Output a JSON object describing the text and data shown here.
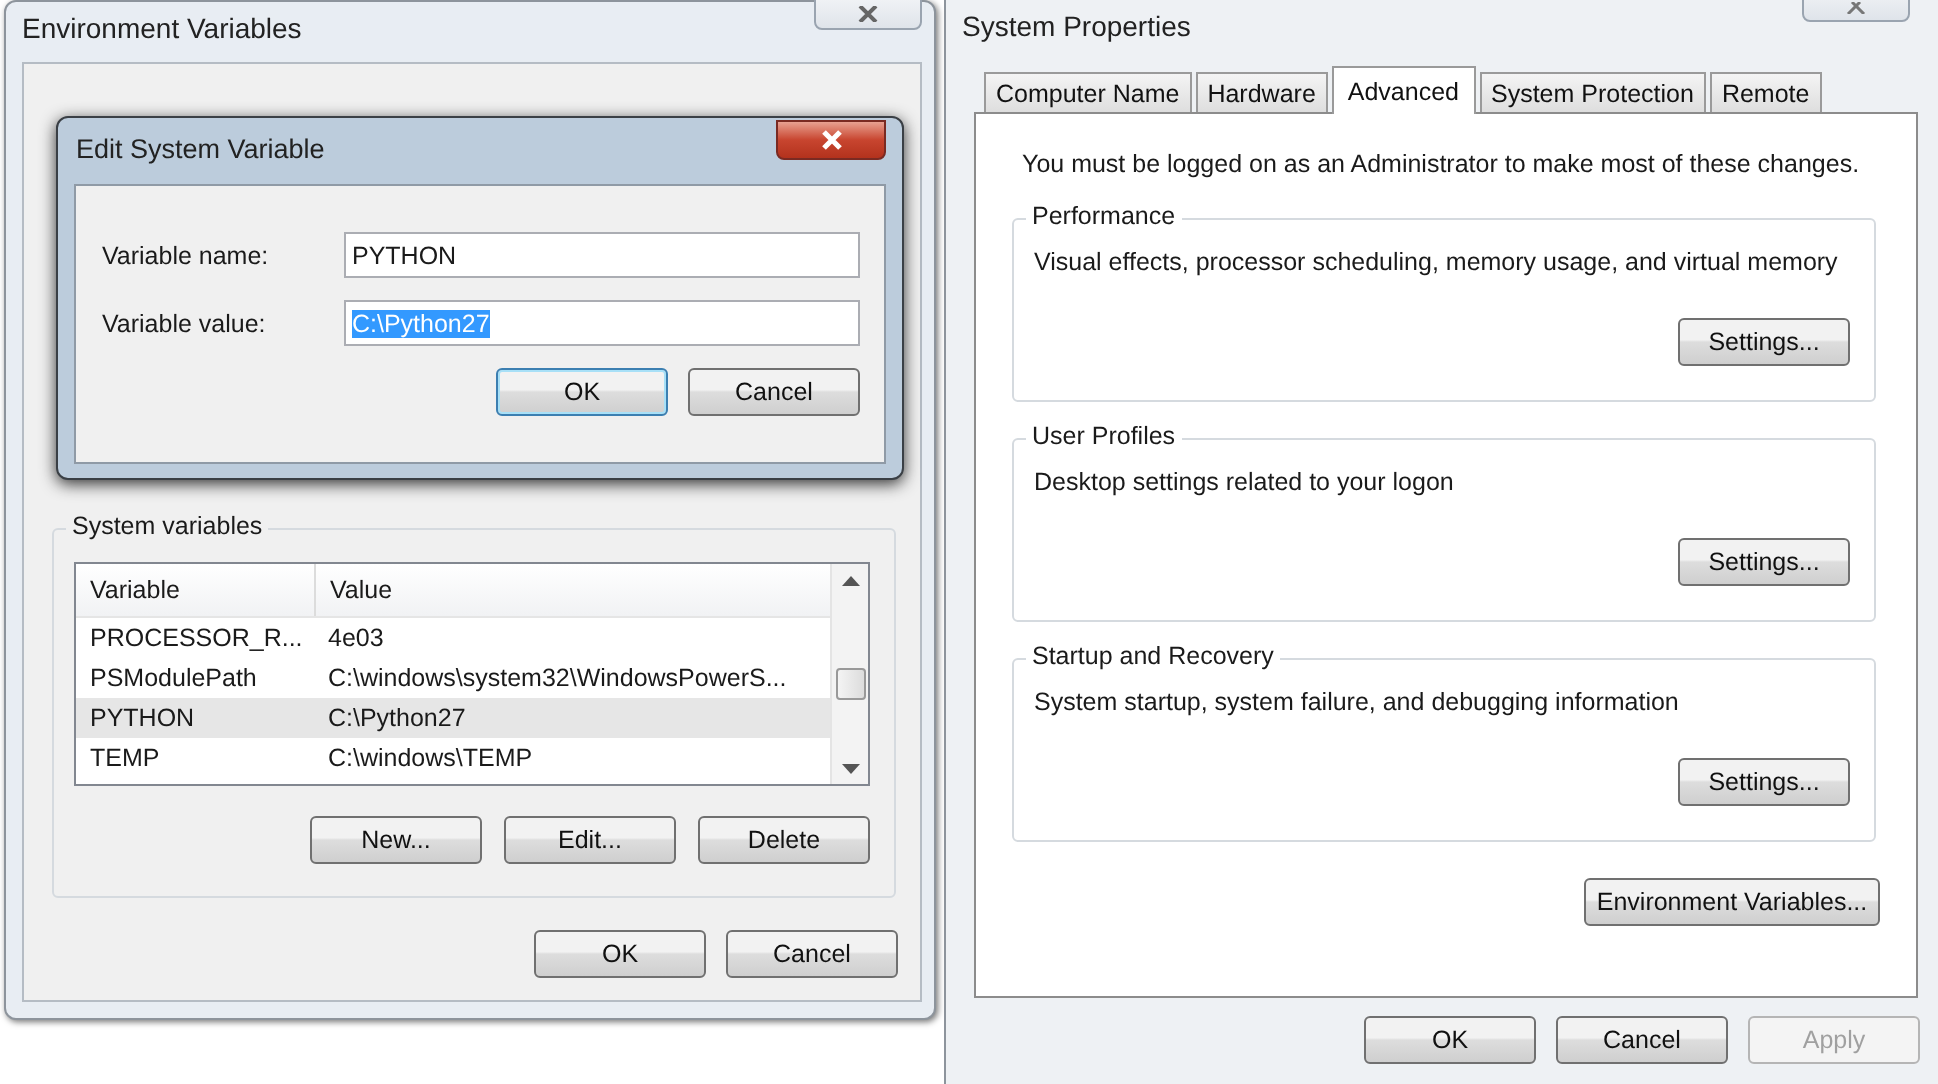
{
  "environment_window": {
    "title": "Environment Variables",
    "system_variables": {
      "label": "System variables",
      "columns": [
        "Variable",
        "Value"
      ],
      "rows": [
        {
          "variable": "PROCESSOR_R...",
          "value": "4e03",
          "selected": false
        },
        {
          "variable": "PSModulePath",
          "value": "C:\\windows\\system32\\WindowsPowerS...",
          "selected": false
        },
        {
          "variable": "PYTHON",
          "value": "C:\\Python27",
          "selected": true
        },
        {
          "variable": "TEMP",
          "value": "C:\\windows\\TEMP",
          "selected": false
        }
      ],
      "buttons": [
        "New...",
        "Edit...",
        "Delete"
      ]
    },
    "buttons": [
      "OK",
      "Cancel"
    ]
  },
  "edit_dialog": {
    "title": "Edit System Variable",
    "fields": [
      {
        "label": "Variable name:",
        "value": "PYTHON",
        "selected": false
      },
      {
        "label": "Variable value:",
        "value": "C:\\Python27",
        "selected": true
      }
    ],
    "buttons": [
      {
        "label": "OK",
        "default": true
      },
      {
        "label": "Cancel",
        "default": false
      }
    ]
  },
  "system_properties": {
    "title": "System Properties",
    "tabs": [
      {
        "label": "Computer Name",
        "selected": false
      },
      {
        "label": "Hardware",
        "selected": false
      },
      {
        "label": "Advanced",
        "selected": true
      },
      {
        "label": "System Protection",
        "selected": false
      },
      {
        "label": "Remote",
        "selected": false
      }
    ],
    "notice": "You must be logged on as an Administrator to make most of these changes.",
    "groups": [
      {
        "title": "Performance",
        "description": "Visual effects, processor scheduling, memory usage, and virtual memory",
        "button": "Settings..."
      },
      {
        "title": "User Profiles",
        "description": "Desktop settings related to your logon",
        "button": "Settings..."
      },
      {
        "title": "Startup and Recovery",
        "description": "System startup, system failure, and debugging information",
        "button": "Settings..."
      }
    ],
    "environment_button": "Environment Variables...",
    "buttons": [
      {
        "label": "OK",
        "disabled": false
      },
      {
        "label": "Cancel",
        "disabled": false
      },
      {
        "label": "Apply",
        "disabled": true
      }
    ]
  }
}
